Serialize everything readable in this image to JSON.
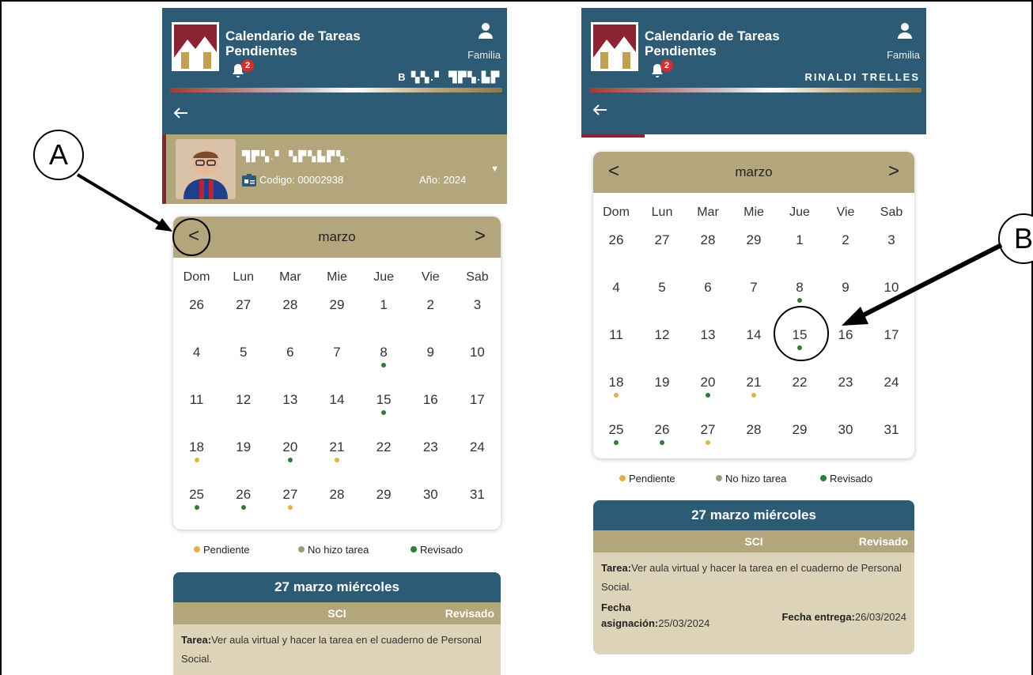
{
  "app": {
    "title": "Calendario de Tareas Pendientes",
    "role": "Familia",
    "notification_count": "2",
    "family_surname_a": "B ▚▚.▘ ▜▛▚.▙▛",
    "family_surname_b": "RINALDI TRELLES"
  },
  "student": {
    "name": "▜▛▚.▘ ▚▛▚▙▛▚.",
    "codigo": "Codigo: 00002938",
    "anio": "Año: 2024"
  },
  "calendar": {
    "month": "marzo",
    "prev_label": "<",
    "next_label": ">",
    "weekdays": [
      "Dom",
      "Lun",
      "Mar",
      "Mie",
      "Jue",
      "Vie",
      "Sab"
    ],
    "weeks": [
      [
        "26",
        "27",
        "28",
        "29",
        "1",
        "2",
        "3"
      ],
      [
        "4",
        "5",
        "6",
        "7",
        "8",
        "9",
        "10"
      ],
      [
        "11",
        "12",
        "13",
        "14",
        "15",
        "16",
        "17"
      ],
      [
        "18",
        "19",
        "20",
        "21",
        "22",
        "23",
        "24"
      ],
      [
        "25",
        "26",
        "27",
        "28",
        "29",
        "30",
        "31"
      ]
    ],
    "dots": [
      {
        "week": 1,
        "day": 4,
        "status": "revisado"
      },
      {
        "week": 2,
        "day": 4,
        "status": "revisado"
      },
      {
        "week": 3,
        "day": 0,
        "status": "pendiente"
      },
      {
        "week": 3,
        "day": 2,
        "status": "revisado"
      },
      {
        "week": 3,
        "day": 3,
        "status": "pendiente"
      },
      {
        "week": 4,
        "day": 0,
        "status": "revisado"
      },
      {
        "week": 4,
        "day": 1,
        "status": "revisado"
      },
      {
        "week": 4,
        "day": 2,
        "status": "pendiente"
      }
    ]
  },
  "legend": {
    "pendiente": "Pendiente",
    "no_hizo": "No hizo tarea",
    "revisado": "Revisado"
  },
  "colors": {
    "pendiente": "#e8b04c",
    "no_hizo": "#9e9a76",
    "revisado": "#2e7d32",
    "header": "#2d5a74",
    "gold": "#b3a67d"
  },
  "detail": {
    "date_title": "27 marzo miércoles",
    "course": "SCI",
    "status": "Revisado",
    "tarea_label": "Tarea:",
    "tarea_text": "Ver aula virtual y hacer la tarea en el cuaderno de Personal Social.",
    "fecha_asig_label": "Fecha asignación:",
    "fecha_asig_value": "25/03/2024",
    "fecha_entrega_label": "Fecha entrega:",
    "fecha_entrega_value": "26/03/2024"
  },
  "annotations": {
    "a": "A",
    "b": "B"
  }
}
